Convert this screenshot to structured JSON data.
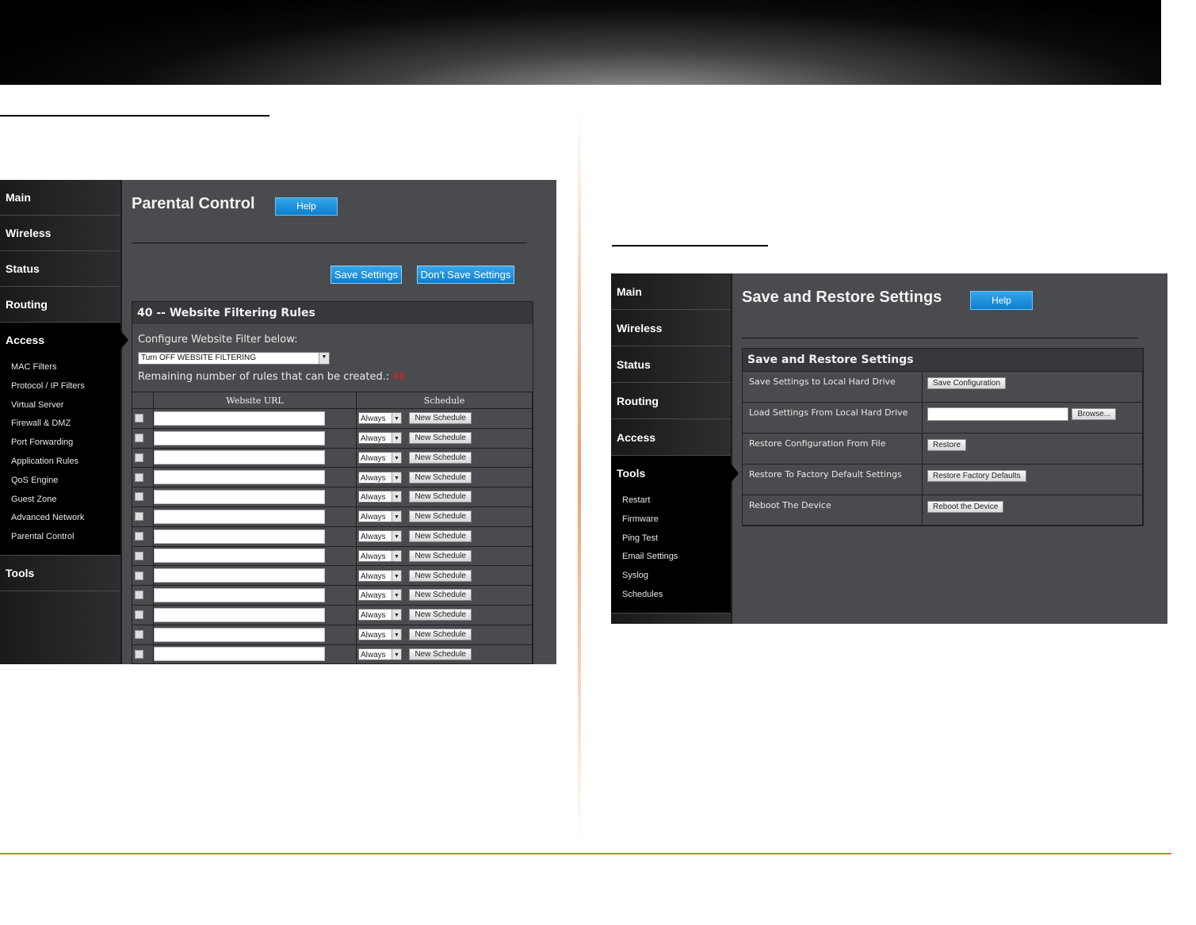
{
  "left": {
    "menu": {
      "main": "Main",
      "wireless": "Wireless",
      "status": "Status",
      "routing": "Routing",
      "access": "Access",
      "access_sub": [
        "MAC Filters",
        "Protocol / IP Filters",
        "Virtual Server",
        "Firewall & DMZ",
        "Port Forwarding",
        "Application Rules",
        "QoS Engine",
        "Guest Zone",
        "Advanced Network",
        "Parental Control"
      ],
      "tools": "Tools"
    },
    "page_title": "Parental Control",
    "help": "Help",
    "save": "Save Settings",
    "dont_save": "Don't Save Settings",
    "panel_title": "40 -- Website Filtering Rules",
    "configure_label": "Configure Website Filter below:",
    "filter_select": "Turn OFF WEBSITE FILTERING",
    "remaining_label": "Remaining number of rules that can be created.:",
    "remaining_value": "40",
    "col_url": "Website URL",
    "col_schedule": "Schedule",
    "row_select": "Always",
    "row_button": "New Schedule",
    "remaining_color": "#d9231c"
  },
  "right": {
    "menu": {
      "main": "Main",
      "wireless": "Wireless",
      "status": "Status",
      "routing": "Routing",
      "access": "Access",
      "tools": "Tools",
      "tools_sub": [
        "Restart",
        "Firmware",
        "Ping Test",
        "Email Settings",
        "Syslog",
        "Schedules"
      ]
    },
    "page_title": "Save and Restore Settings",
    "help": "Help",
    "panel_title": "Save and Restore Settings",
    "rows": [
      {
        "label": "Save Settings to Local Hard Drive",
        "button": "Save Configuration"
      },
      {
        "label": "Load Settings From Local Hard Drive",
        "button": "Browse..."
      },
      {
        "label": "Restore Configuration From File",
        "button": "Restore"
      },
      {
        "label": "Restore To Factory Default Settings",
        "button": "Restore Factory Defaults"
      },
      {
        "label": "Reboot The Device",
        "button": "Reboot the Device"
      }
    ]
  },
  "colors": {
    "accent_orange": "#e8722e",
    "button_blue": "#1790dd"
  }
}
